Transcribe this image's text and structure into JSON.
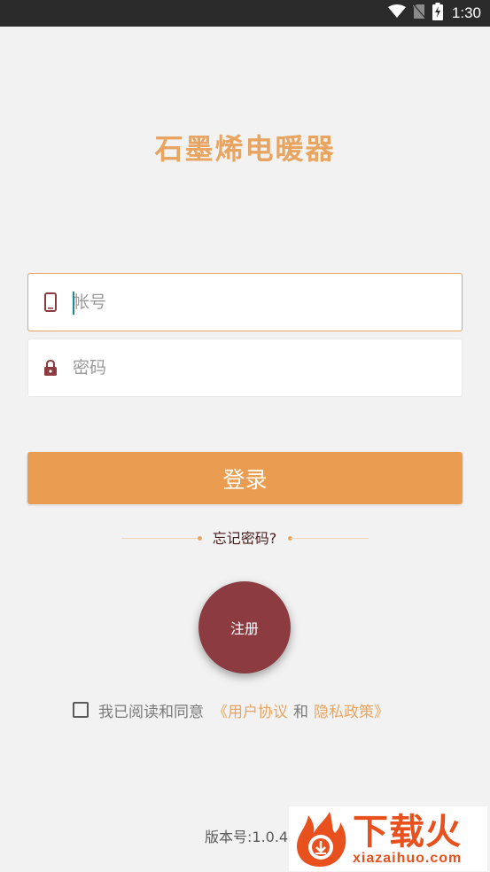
{
  "status_bar": {
    "time": "1:30",
    "icons": [
      "wifi-icon",
      "no-sim-icon",
      "battery-charging-icon"
    ]
  },
  "app": {
    "title": "石墨烯电暖器",
    "title_color": "#e8a562"
  },
  "login_form": {
    "account_placeholder": "帐号",
    "account_value": "",
    "account_icon": "phone-icon",
    "password_placeholder": "密码",
    "password_value": "",
    "password_icon": "lock-icon",
    "login_label": "登录",
    "forgot_password": "忘记密码?"
  },
  "register": {
    "label": "注册"
  },
  "agreement": {
    "checked": false,
    "prefix": "我已阅读和同意",
    "user_agreement": "《用户协议",
    "conjunction": "和",
    "privacy_policy": "隐私政策》"
  },
  "footer": {
    "version": "版本号:1.0.4"
  },
  "watermark": {
    "title": "下载火",
    "url": "xiazaihuo.com"
  },
  "colors": {
    "accent": "#e8a562",
    "login_button": "#ea9d50",
    "register_button": "#8c3c40",
    "icon_dark_red": "#8c3c40",
    "background": "#f2f2f2"
  }
}
